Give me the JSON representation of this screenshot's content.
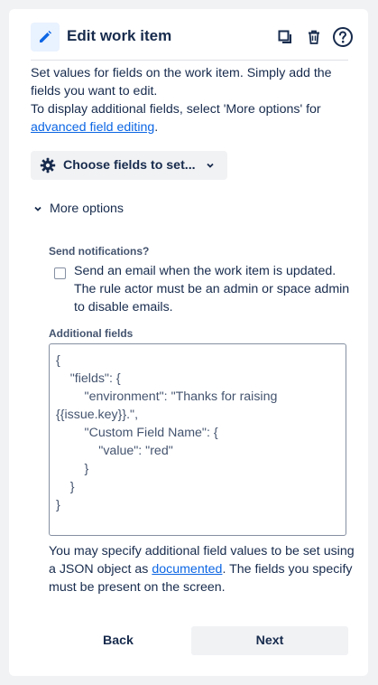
{
  "header": {
    "title": "Edit work item",
    "icons": [
      "pencil-icon",
      "copy-icon",
      "trash-icon",
      "help-icon"
    ]
  },
  "description": {
    "line1": "Set values for fields on the work item. Simply add the fields you want to edit.",
    "line2_prefix": "To display additional fields, select 'More options' for ",
    "line2_link": "advanced field editing",
    "line2_suffix": "."
  },
  "choose_fields": {
    "label": "Choose fields to set..."
  },
  "more_options": {
    "label": "More options"
  },
  "notifications": {
    "label": "Send notifications?",
    "checkbox_text": "Send an email when the work item is updated. The rule actor must be an admin or space admin to disable emails.",
    "checked": false
  },
  "additional_fields": {
    "label": "Additional fields",
    "lines": [
      "{",
      "    \"fields\": {",
      "        \"environment\": \"Thanks for raising",
      "{{issue.key}}.\",",
      "        \"Custom Field Name\": {",
      "            \"value\": \"red\"",
      "        }",
      "    }",
      "}"
    ]
  },
  "help_text": {
    "prefix": "You may specify additional field values to be set using a JSON object as ",
    "link": "documented",
    "suffix": ". The fields you specify must be present on the screen."
  },
  "footer": {
    "back_label": "Back",
    "next_label": "Next"
  },
  "colors": {
    "accent": "#0c66e4",
    "text": "#172b4d",
    "subtle": "#44546f",
    "button_bg": "#f1f2f4"
  }
}
